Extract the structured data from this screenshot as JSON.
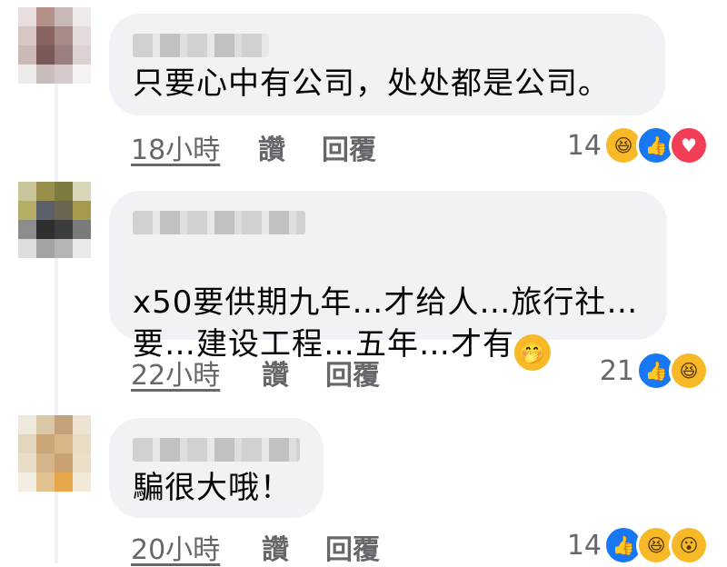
{
  "comments": [
    {
      "text": "只要心中有公司，处处都是公司。",
      "time": "18小時",
      "like": "讚",
      "reply": "回覆",
      "count": "14",
      "reactions": [
        "laugh-icon",
        "like-icon",
        "love-icon"
      ]
    },
    {
      "text": "x50要供期九年…才给人…旅行社…\n要…建设工程…五年…才有",
      "inline_emoji": "face-with-hand-over-mouth-emoji",
      "time": "22小時",
      "like": "讚",
      "reply": "回覆",
      "count": "21",
      "reactions": [
        "like-icon",
        "laugh-icon"
      ]
    },
    {
      "text": "騙很大哦！",
      "time": "20小時",
      "like": "讚",
      "reply": "回覆",
      "count": "14",
      "reactions": [
        "like-icon",
        "laugh-icon",
        "wow-icon"
      ]
    }
  ],
  "colors": {
    "bubble": "#f0f2f5",
    "meta": "#65676b",
    "like": "#1877f2",
    "laugh": "#f7b928",
    "love": "#f33e58"
  }
}
